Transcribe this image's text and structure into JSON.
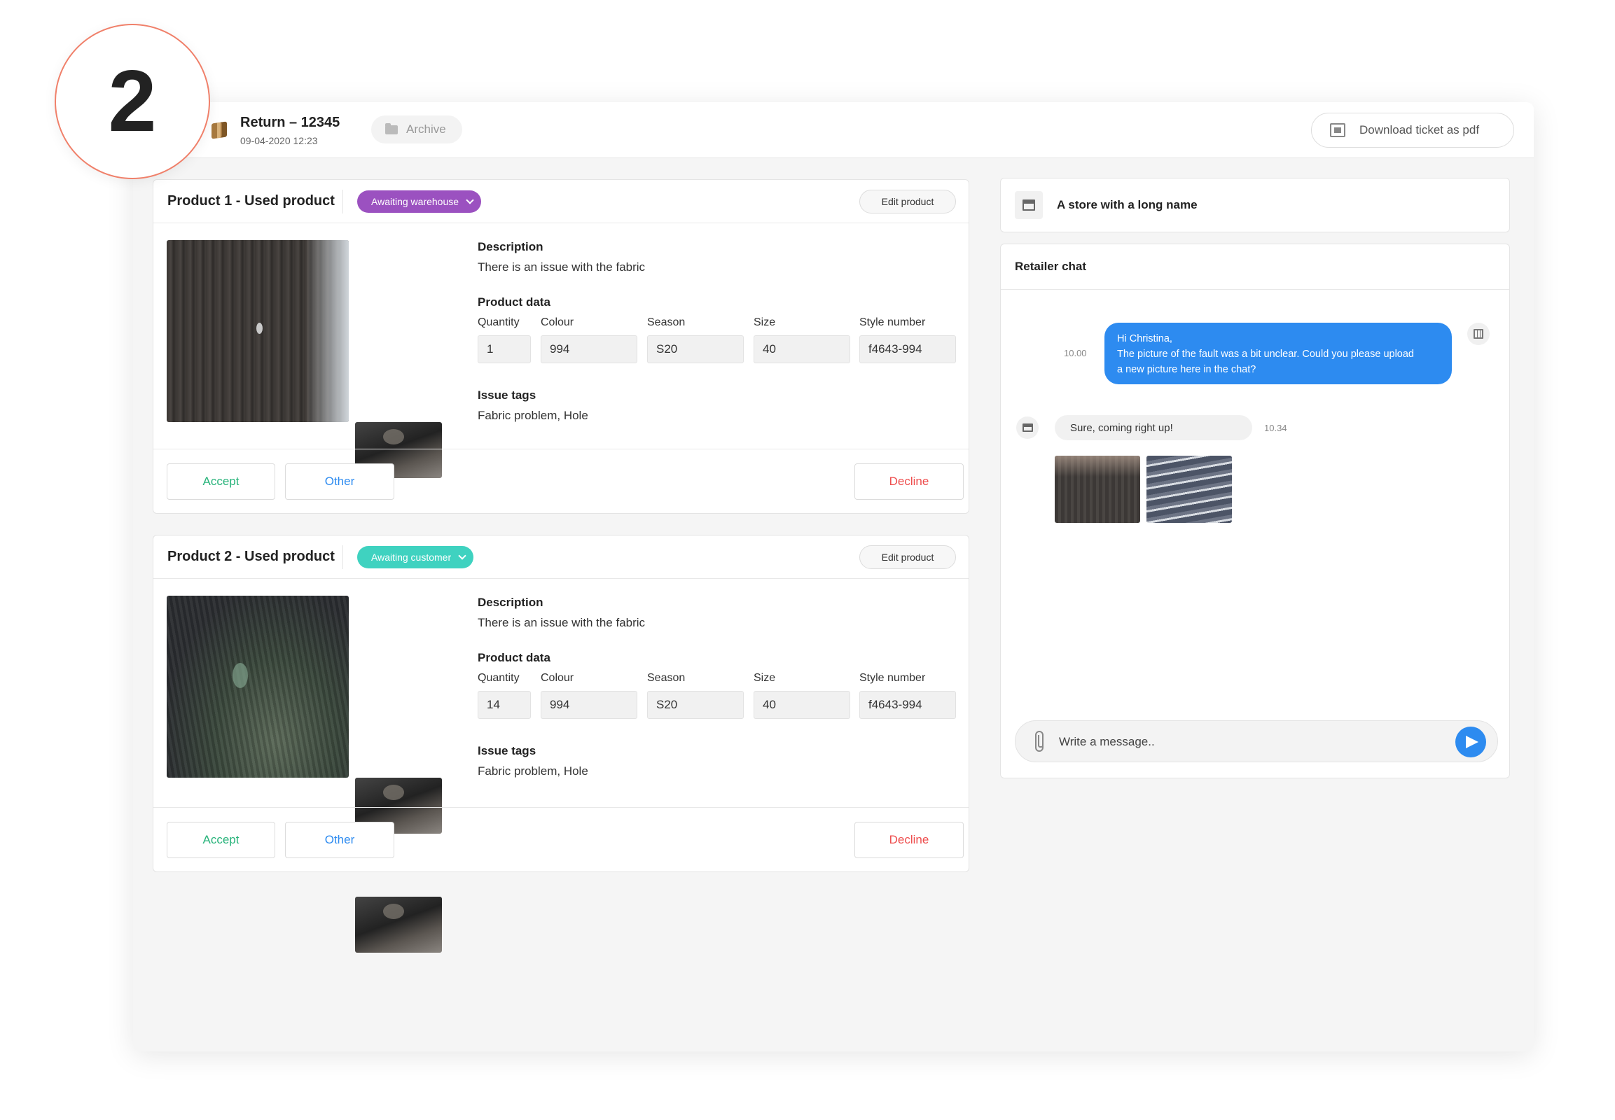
{
  "step": {
    "number": "2"
  },
  "header": {
    "title": "Return – 12345",
    "date": "09-04-2020 12:23",
    "archive_label": "Archive",
    "download_label": "Download ticket as pdf"
  },
  "labels": {
    "description": "Description",
    "product_data": "Product data",
    "issue_tags": "Issue tags",
    "quantity": "Quantity",
    "colour": "Colour",
    "season": "Season",
    "size": "Size",
    "style_number": "Style number",
    "edit_product": "Edit product",
    "accept": "Accept",
    "other": "Other",
    "decline": "Decline"
  },
  "products": [
    {
      "title": "Product 1 - Used product",
      "status": "Awaiting warehouse",
      "status_color": "#9b51c0",
      "description": "There is an issue with the fabric",
      "quantity": "1",
      "colour": "994",
      "season": "S20",
      "size": "40",
      "style_number": "f4643-994",
      "issue_tags": "Fabric problem, Hole"
    },
    {
      "title": "Product 2 - Used product",
      "status": "Awaiting customer",
      "status_color": "#3fd2c0",
      "description": "There is an issue with the fabric",
      "quantity": "14",
      "colour": "994",
      "season": "S20",
      "size": "40",
      "style_number": "f4643-994",
      "issue_tags": "Fabric problem, Hole"
    }
  ],
  "colors": {
    "accept": "#27b37a",
    "other": "#2d8bf0",
    "decline": "#ee4d4d",
    "chat_bubble": "#2d8bf0"
  },
  "store": {
    "name": "A store with a long name"
  },
  "chat": {
    "title": "Retailer chat",
    "messages": [
      {
        "time": "10.00",
        "line1": "Hi Christina,",
        "line2": "The picture of the fault was a bit unclear. Could you please upload",
        "line3": "a new picture here in the chat?"
      },
      {
        "time": "10.34",
        "text": "Sure, coming right up!"
      }
    ],
    "placeholder": "Write a message.."
  }
}
